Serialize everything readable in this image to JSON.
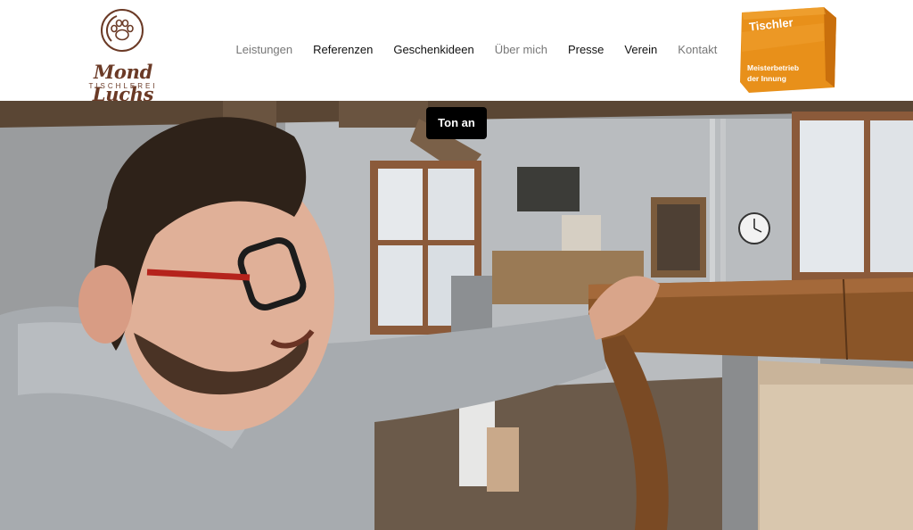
{
  "header": {
    "logo": {
      "brand": "Mond Luchs",
      "sub": "TISCHLEREI"
    },
    "nav": [
      {
        "label": "Leistungen",
        "muted": true
      },
      {
        "label": "Referenzen",
        "muted": false
      },
      {
        "label": "Geschenkideen",
        "muted": false
      },
      {
        "label": "Über mich",
        "muted": true
      },
      {
        "label": "Presse",
        "muted": false
      },
      {
        "label": "Verein",
        "muted": false
      },
      {
        "label": "Kontakt",
        "muted": true
      }
    ],
    "badge": {
      "title": "Tischler",
      "line1": "Meisterbetrieb",
      "line2": "der Innung"
    }
  },
  "hero": {
    "sound_button": "Ton an"
  },
  "colors": {
    "brand_brown": "#6b3a26",
    "badge_orange": "#e8901a"
  }
}
